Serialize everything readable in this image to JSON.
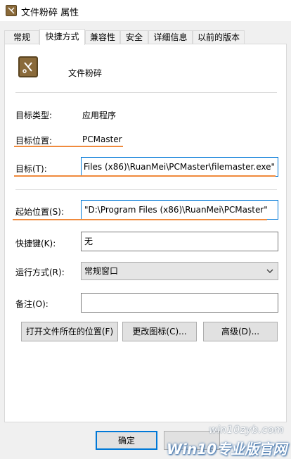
{
  "window": {
    "title": "文件粉碎 属性"
  },
  "tabs": [
    {
      "label": "常规"
    },
    {
      "label": "快捷方式"
    },
    {
      "label": "兼容性"
    },
    {
      "label": "安全"
    },
    {
      "label": "详细信息"
    },
    {
      "label": "以前的版本"
    }
  ],
  "app": {
    "name": "文件粉碎"
  },
  "fields": {
    "target_type_label": "目标类型:",
    "target_type_value": "应用程序",
    "target_location_label": "目标位置:",
    "target_location_value": "PCMaster",
    "target_label": "目标(T):",
    "target_value": "Files (x86)\\RuanMei\\PCMaster\\filemaster.exe\"",
    "start_in_label": "起始位置(S):",
    "start_in_value": "\"D:\\Program Files (x86)\\RuanMei\\PCMaster\"",
    "shortcut_key_label": "快捷键(K):",
    "shortcut_key_value": "无",
    "run_label": "运行方式(R):",
    "run_value": "常规窗口",
    "comment_label": "备注(O):",
    "comment_value": ""
  },
  "buttons": {
    "open_location": "打开文件所在的位置(F)",
    "change_icon": "更改图标(C)...",
    "advanced": "高级(D)...",
    "ok": "确定"
  },
  "watermark": {
    "site": "win10zyb.com",
    "brand": "Win10专业版官网"
  },
  "colors": {
    "highlight_underline": "#f08a3c",
    "focus_border": "#0078d7"
  }
}
